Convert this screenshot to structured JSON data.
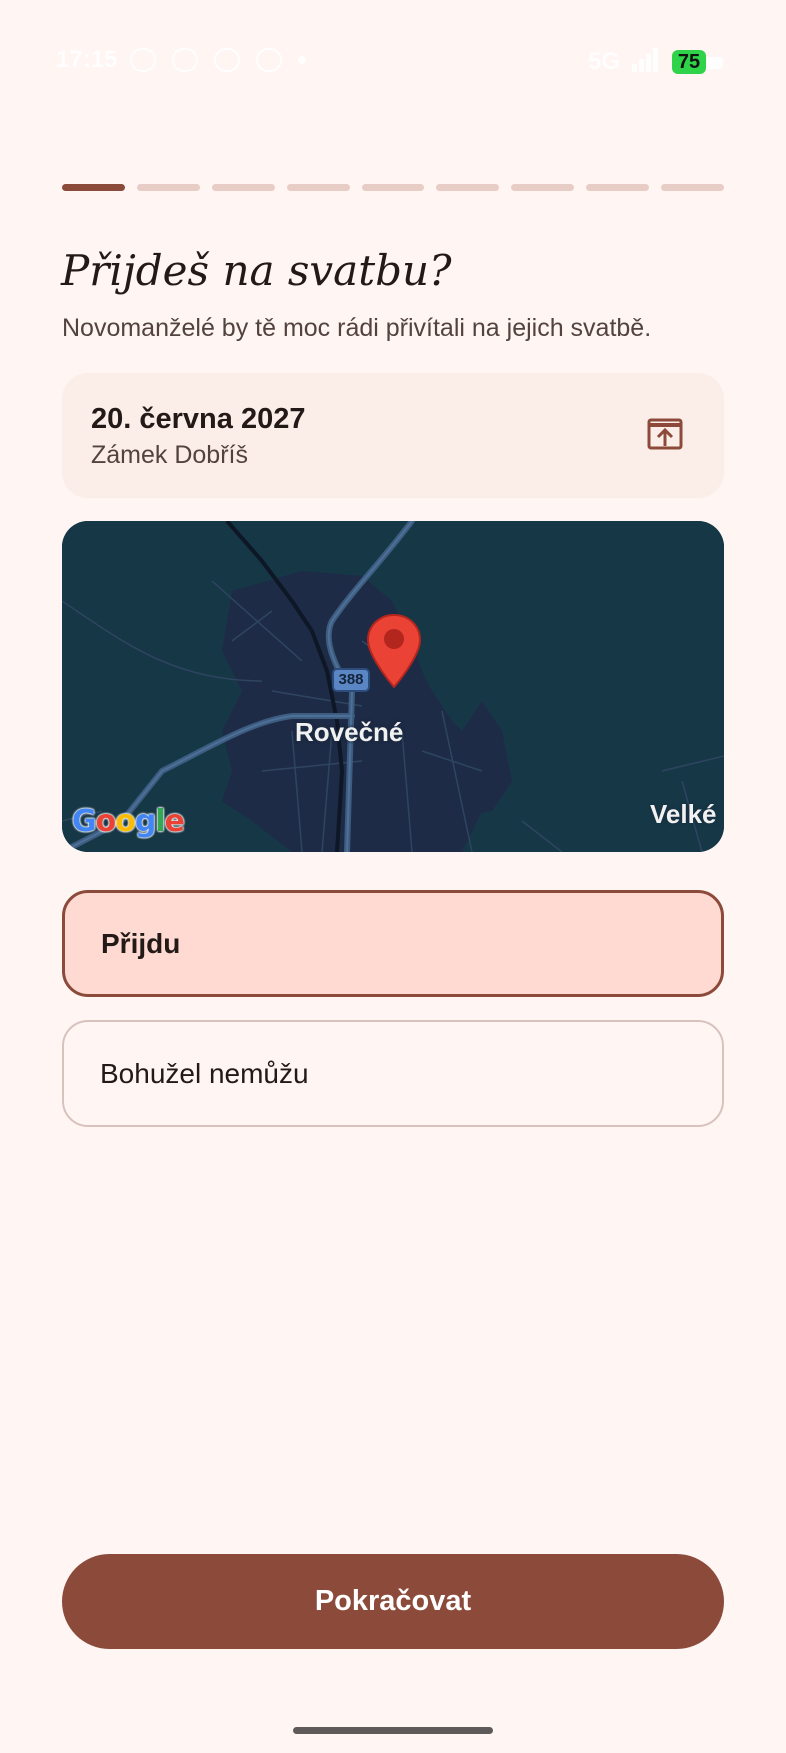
{
  "status_bar": {
    "time": "17:15",
    "network": "5G",
    "battery": "75"
  },
  "progress": {
    "total_steps": 9,
    "current_step": 1
  },
  "page": {
    "title": "Přijdeš na svatbu?",
    "subtitle": "Novomanželé by tě moc rádi přivítali na jejich svatbě."
  },
  "event": {
    "date": "20. června 2027",
    "venue": "Zámek Dobříš",
    "open_icon": "open-in-new-icon"
  },
  "map": {
    "town_label": "Rovečné",
    "town_label_2": "Velké",
    "road_number": "388",
    "logo_text": "Google",
    "logo_colors": [
      "#4285F4",
      "#EA4335",
      "#FBBC05",
      "#4285F4",
      "#34A853",
      "#EA4335"
    ],
    "pin_color": "#ea4335"
  },
  "options": [
    {
      "label": "Přijdu",
      "selected": true
    },
    {
      "label": "Bohužel nemůžu",
      "selected": false
    }
  ],
  "actions": {
    "continue_label": "Pokračovat"
  },
  "colors": {
    "accent": "#8c4a3b",
    "background": "#fff5f3",
    "selected_fill": "#ffdad3",
    "progress_inactive": "#e8cdc6"
  }
}
